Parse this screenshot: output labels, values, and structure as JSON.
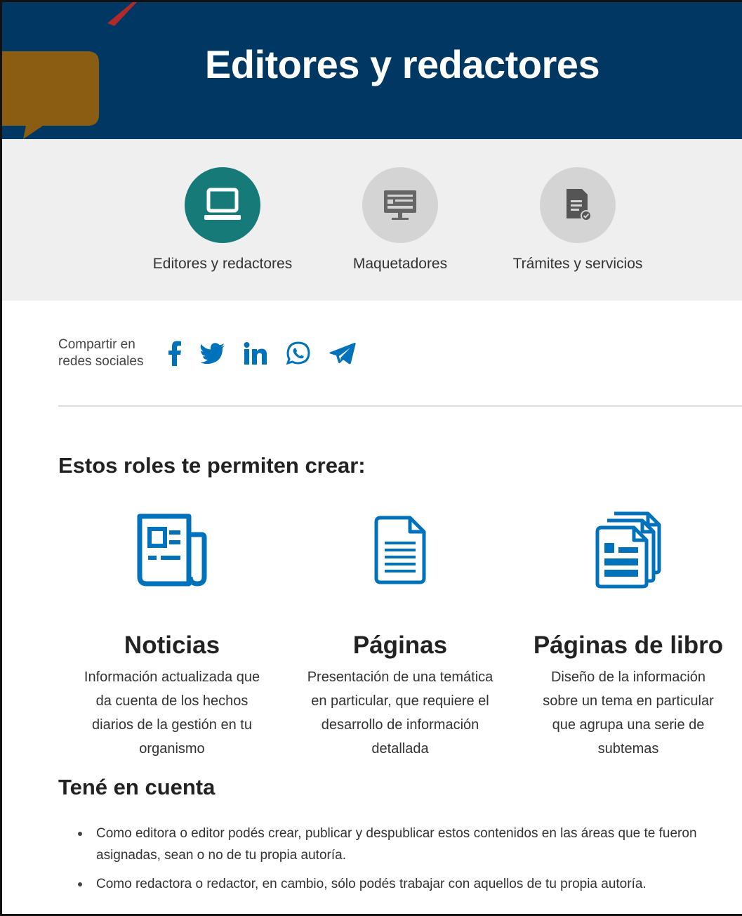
{
  "header": {
    "title": "Editores y redactores",
    "background_color": "#003863"
  },
  "roles": {
    "items": [
      {
        "label": "Editores y redactores",
        "icon": "laptop-icon",
        "active": true,
        "color": "#167a78"
      },
      {
        "label": "Maquetadores",
        "icon": "monitor-layout-icon",
        "active": false,
        "color": "#d4d4d4"
      },
      {
        "label": "Trámites y servicios",
        "icon": "document-check-icon",
        "active": false,
        "color": "#d4d4d4"
      }
    ]
  },
  "share": {
    "label_line1": "Compartir en",
    "label_line2": "redes sociales",
    "networks": [
      "facebook-icon",
      "twitter-icon",
      "linkedin-icon",
      "whatsapp-icon",
      "telegram-icon"
    ],
    "icon_color": "#0072bb"
  },
  "create": {
    "title": "Estos roles te permiten crear:",
    "cards": [
      {
        "title": "Noticias",
        "description": "Información actualizada que da cuenta de los hechos diarios de la gestión en tu organismo",
        "icon": "newspaper-icon"
      },
      {
        "title": "Páginas",
        "description": "Presentación de una temática en particular, que requiere el desarrollo de información detallada",
        "icon": "page-icon"
      },
      {
        "title": "Páginas de libro",
        "description": "Diseño de la información sobre un tema en particular que agrupa una serie de subtemas",
        "icon": "book-pages-icon"
      }
    ]
  },
  "notes": {
    "title": "Tené en cuenta",
    "items": [
      "Como editora o editor podés crear, publicar y despublicar estos contenidos en las áreas que te fueron asignadas, sean o no de tu propia autoría.",
      "Como redactora o redactor, en cambio, sólo podés trabajar con aquellos de tu propia autoría."
    ]
  }
}
